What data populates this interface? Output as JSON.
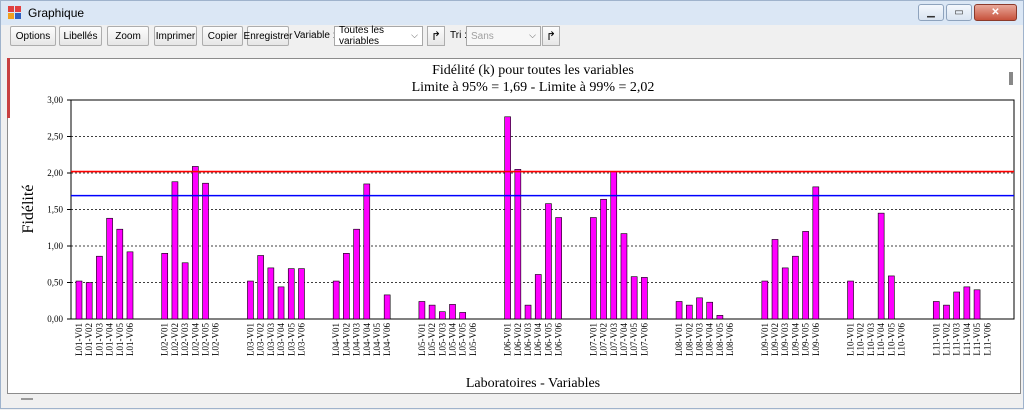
{
  "window": {
    "title": "Graphique"
  },
  "toolbar": {
    "options": "Options",
    "libelles": "Libellés",
    "zoom": "Zoom",
    "imprimer": "Imprimer",
    "copier": "Copier",
    "enregistrer": "Enregistrer",
    "variable_label": "Variable :",
    "variable_value": "Toutes les variables",
    "tri_label": "Tri :",
    "tri_value": "Sans"
  },
  "colors": {
    "bar": "#ff00ff",
    "limit95": "#0000ff",
    "limit99": "#ff0000"
  },
  "chart_data": {
    "type": "bar",
    "title": "Fidélité (k) pour toutes les variables",
    "subtitle": "Limite à 95% = 1,69 - Limite à 99% = 2,02",
    "xlabel": "Laboratoires - Variables",
    "ylabel": "Fidélité",
    "ylim": [
      0,
      3
    ],
    "yticks": [
      "0,00",
      "0,50",
      "1,00",
      "1,50",
      "2,00",
      "2,50",
      "3,00"
    ],
    "grid": "dashed horizontal",
    "limits": [
      {
        "label": "Limite à 95%",
        "value": 1.69,
        "color": "#0000ff"
      },
      {
        "label": "Limite à 99%",
        "value": 2.02,
        "color": "#ff0000"
      }
    ],
    "groups": [
      {
        "labels": [
          "L01-V01",
          "L01-V02",
          "L01-V03",
          "L01-V04",
          "L01-V05",
          "L01-V06"
        ],
        "values": [
          0.52,
          0.5,
          0.86,
          1.38,
          1.23,
          0.92
        ]
      },
      {
        "labels": [
          "L02-V01",
          "L02-V02",
          "L02-V03",
          "L02-V04",
          "L02-V05",
          "L02-V06"
        ],
        "values": [
          0.9,
          1.88,
          0.77,
          2.09,
          1.86,
          0
        ]
      },
      {
        "labels": [
          "L03-V01",
          "L03-V02",
          "L03-V03",
          "L03-V04",
          "L03-V05",
          "L03-V06"
        ],
        "values": [
          0.52,
          0.87,
          0.7,
          0.44,
          0.69,
          0.69
        ]
      },
      {
        "labels": [
          "L04-V01",
          "L04-V02",
          "L04-V03",
          "L04-V04",
          "L04-V05",
          "L04-V06"
        ],
        "values": [
          0.52,
          0.9,
          1.23,
          1.85,
          0,
          0.33
        ]
      },
      {
        "labels": [
          "L05-V01",
          "L05-V02",
          "L05-V03",
          "L05-V04",
          "L05-V05",
          "L05-V06"
        ],
        "values": [
          0.24,
          0.19,
          0.1,
          0.2,
          0.09,
          0
        ]
      },
      {
        "labels": [
          "L06-V01",
          "L06-V02",
          "L06-V03",
          "L06-V04",
          "L06-V05",
          "L06-V06"
        ],
        "values": [
          2.77,
          2.05,
          0.19,
          0.61,
          1.58,
          1.39
        ]
      },
      {
        "labels": [
          "L07-V01",
          "L07-V02",
          "L07-V03",
          "L07-V04",
          "L07-V05",
          "L07-V06"
        ],
        "values": [
          1.39,
          1.64,
          2.02,
          1.17,
          0.58,
          0.57
        ]
      },
      {
        "labels": [
          "L08-V01",
          "L08-V02",
          "L08-V03",
          "L08-V04",
          "L08-V05",
          "L08-V06"
        ],
        "values": [
          0.24,
          0.19,
          0.29,
          0.23,
          0.05,
          0
        ]
      },
      {
        "labels": [
          "L09-V01",
          "L09-V02",
          "L09-V03",
          "L09-V04",
          "L09-V05",
          "L09-V06"
        ],
        "values": [
          0.52,
          1.09,
          0.7,
          0.86,
          1.2,
          1.81
        ]
      },
      {
        "labels": [
          "L10-V01",
          "L10-V02",
          "L10-V03",
          "L10-V04",
          "L10-V05",
          "L10-V06"
        ],
        "values": [
          0.52,
          0,
          0,
          1.45,
          0.59,
          0
        ]
      },
      {
        "labels": [
          "L11-V01",
          "L11-V02",
          "L11-V03",
          "L11-V04",
          "L11-V05",
          "L11-V06"
        ],
        "values": [
          0.24,
          0.19,
          0.37,
          0.44,
          0.4,
          0
        ]
      }
    ]
  }
}
